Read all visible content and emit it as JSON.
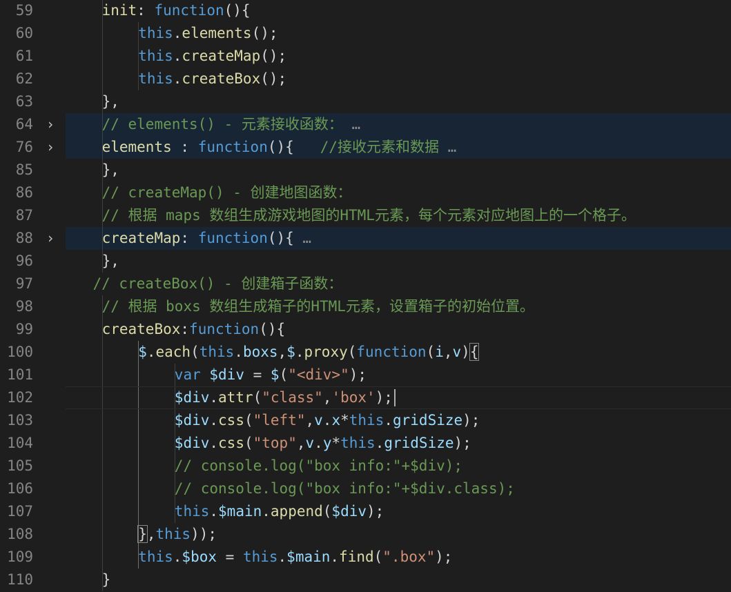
{
  "editor": {
    "theme": {
      "background": "#1e1e1e",
      "highlight": "#172534",
      "line_number": "#858585"
    },
    "lines": [
      {
        "n": "59",
        "fold": false,
        "hl": false,
        "indent": 2,
        "tokens": [
          {
            "t": "init",
            "c": "fn"
          },
          {
            "t": ": ",
            "c": "pn"
          },
          {
            "t": "function",
            "c": "kw"
          },
          {
            "t": "(){",
            "c": "pn"
          }
        ]
      },
      {
        "n": "60",
        "fold": false,
        "hl": false,
        "indent": 3,
        "tokens": [
          {
            "t": "this",
            "c": "kw"
          },
          {
            "t": ".",
            "c": "pn"
          },
          {
            "t": "elements",
            "c": "fn"
          },
          {
            "t": "();",
            "c": "pn"
          }
        ]
      },
      {
        "n": "61",
        "fold": false,
        "hl": false,
        "indent": 3,
        "tokens": [
          {
            "t": "this",
            "c": "kw"
          },
          {
            "t": ".",
            "c": "pn"
          },
          {
            "t": "createMap",
            "c": "fn"
          },
          {
            "t": "();",
            "c": "pn"
          }
        ]
      },
      {
        "n": "62",
        "fold": false,
        "hl": false,
        "indent": 3,
        "tokens": [
          {
            "t": "this",
            "c": "kw"
          },
          {
            "t": ".",
            "c": "pn"
          },
          {
            "t": "createBox",
            "c": "fn"
          },
          {
            "t": "();",
            "c": "pn"
          }
        ]
      },
      {
        "n": "63",
        "fold": false,
        "hl": false,
        "indent": 2,
        "tokens": [
          {
            "t": "},",
            "c": "pn"
          }
        ]
      },
      {
        "n": "64",
        "fold": true,
        "hl": true,
        "indent": 2,
        "tokens": [
          {
            "t": "// elements() - 元素接收函数：",
            "c": "cm"
          },
          {
            "t": " …",
            "c": "ell"
          }
        ]
      },
      {
        "n": "76",
        "fold": true,
        "hl": true,
        "indent": 2,
        "tokens": [
          {
            "t": "elements",
            "c": "fn"
          },
          {
            "t": " : ",
            "c": "pn"
          },
          {
            "t": "function",
            "c": "kw"
          },
          {
            "t": "(){   ",
            "c": "pn"
          },
          {
            "t": "//接收元素和数据",
            "c": "cm"
          },
          {
            "t": " …",
            "c": "ell"
          }
        ]
      },
      {
        "n": "85",
        "fold": false,
        "hl": false,
        "indent": 2,
        "tokens": [
          {
            "t": "},",
            "c": "pn"
          }
        ]
      },
      {
        "n": "86",
        "fold": false,
        "hl": false,
        "indent": 2,
        "tokens": [
          {
            "t": "// createMap() - 创建地图函数：",
            "c": "cm"
          }
        ]
      },
      {
        "n": "87",
        "fold": false,
        "hl": false,
        "indent": 2,
        "tokens": [
          {
            "t": "// 根据 maps 数组生成游戏地图的HTML元素，每个元素对应地图上的一个格子。",
            "c": "cm"
          }
        ]
      },
      {
        "n": "88",
        "fold": true,
        "hl": true,
        "indent": 2,
        "tokens": [
          {
            "t": "createMap",
            "c": "fn"
          },
          {
            "t": ": ",
            "c": "pn"
          },
          {
            "t": "function",
            "c": "kw"
          },
          {
            "t": "(){",
            "c": "pn"
          },
          {
            "t": " …",
            "c": "ell"
          }
        ]
      },
      {
        "n": "96",
        "fold": false,
        "hl": false,
        "indent": 2,
        "tokens": [
          {
            "t": "},",
            "c": "pn"
          }
        ]
      },
      {
        "n": "97",
        "fold": false,
        "hl": false,
        "indent": 1.75,
        "tokens": [
          {
            "t": "// createBox() - 创建箱子函数：",
            "c": "cm"
          }
        ]
      },
      {
        "n": "98",
        "fold": false,
        "hl": false,
        "indent": 2,
        "tokens": [
          {
            "t": "// 根据 boxs 数组生成箱子的HTML元素，设置箱子的初始位置。",
            "c": "cm"
          }
        ]
      },
      {
        "n": "99",
        "fold": false,
        "hl": false,
        "indent": 2,
        "tokens": [
          {
            "t": "createBox",
            "c": "fn"
          },
          {
            "t": ":",
            "c": "pn"
          },
          {
            "t": "function",
            "c": "kw"
          },
          {
            "t": "(){",
            "c": "pn"
          }
        ]
      },
      {
        "n": "100",
        "fold": false,
        "hl": false,
        "indent": 3,
        "tokens": [
          {
            "t": "$",
            "c": "vr"
          },
          {
            "t": ".",
            "c": "pn"
          },
          {
            "t": "each",
            "c": "fn"
          },
          {
            "t": "(",
            "c": "pn"
          },
          {
            "t": "this",
            "c": "kw"
          },
          {
            "t": ".",
            "c": "pn"
          },
          {
            "t": "boxs",
            "c": "pr"
          },
          {
            "t": ",",
            "c": "pn"
          },
          {
            "t": "$",
            "c": "vr"
          },
          {
            "t": ".",
            "c": "pn"
          },
          {
            "t": "proxy",
            "c": "fn"
          },
          {
            "t": "(",
            "c": "pn"
          },
          {
            "t": "function",
            "c": "kw"
          },
          {
            "t": "(",
            "c": "pn"
          },
          {
            "t": "i",
            "c": "pr"
          },
          {
            "t": ",",
            "c": "pn"
          },
          {
            "t": "v",
            "c": "pr"
          },
          {
            "t": ")",
            "c": "pn"
          },
          {
            "t": "{",
            "c": "pn",
            "box": true
          }
        ]
      },
      {
        "n": "101",
        "fold": false,
        "hl": false,
        "indent": 4,
        "tokens": [
          {
            "t": "var",
            "c": "kw"
          },
          {
            "t": " ",
            "c": "pn"
          },
          {
            "t": "$div",
            "c": "vr"
          },
          {
            "t": " = ",
            "c": "pn"
          },
          {
            "t": "$",
            "c": "vr"
          },
          {
            "t": "(",
            "c": "pn"
          },
          {
            "t": "\"<div>\"",
            "c": "str"
          },
          {
            "t": ");",
            "c": "pn"
          }
        ]
      },
      {
        "n": "102",
        "fold": false,
        "hl": false,
        "cur": true,
        "indent": 4,
        "tokens": [
          {
            "t": "$div",
            "c": "vr"
          },
          {
            "t": ".",
            "c": "pn"
          },
          {
            "t": "attr",
            "c": "fn"
          },
          {
            "t": "(",
            "c": "pn"
          },
          {
            "t": "\"class\"",
            "c": "str"
          },
          {
            "t": ",",
            "c": "pn"
          },
          {
            "t": "'box'",
            "c": "str"
          },
          {
            "t": ");",
            "c": "pn"
          }
        ]
      },
      {
        "n": "103",
        "fold": false,
        "hl": false,
        "indent": 4,
        "tokens": [
          {
            "t": "$div",
            "c": "vr"
          },
          {
            "t": ".",
            "c": "pn"
          },
          {
            "t": "css",
            "c": "fn"
          },
          {
            "t": "(",
            "c": "pn"
          },
          {
            "t": "\"left\"",
            "c": "str"
          },
          {
            "t": ",",
            "c": "pn"
          },
          {
            "t": "v",
            "c": "pr"
          },
          {
            "t": ".",
            "c": "pn"
          },
          {
            "t": "x",
            "c": "pr"
          },
          {
            "t": "*",
            "c": "pn"
          },
          {
            "t": "this",
            "c": "kw"
          },
          {
            "t": ".",
            "c": "pn"
          },
          {
            "t": "gridSize",
            "c": "pr"
          },
          {
            "t": ");",
            "c": "pn"
          }
        ]
      },
      {
        "n": "104",
        "fold": false,
        "hl": false,
        "indent": 4,
        "tokens": [
          {
            "t": "$div",
            "c": "vr"
          },
          {
            "t": ".",
            "c": "pn"
          },
          {
            "t": "css",
            "c": "fn"
          },
          {
            "t": "(",
            "c": "pn"
          },
          {
            "t": "\"top\"",
            "c": "str"
          },
          {
            "t": ",",
            "c": "pn"
          },
          {
            "t": "v",
            "c": "pr"
          },
          {
            "t": ".",
            "c": "pn"
          },
          {
            "t": "y",
            "c": "pr"
          },
          {
            "t": "*",
            "c": "pn"
          },
          {
            "t": "this",
            "c": "kw"
          },
          {
            "t": ".",
            "c": "pn"
          },
          {
            "t": "gridSize",
            "c": "pr"
          },
          {
            "t": ");",
            "c": "pn"
          }
        ]
      },
      {
        "n": "105",
        "fold": false,
        "hl": false,
        "indent": 4,
        "tokens": [
          {
            "t": "// console.log(\"box info:\"+$div);",
            "c": "cm"
          }
        ]
      },
      {
        "n": "106",
        "fold": false,
        "hl": false,
        "indent": 4,
        "tokens": [
          {
            "t": "// console.log(\"box info:\"+$div.class);",
            "c": "cm"
          }
        ]
      },
      {
        "n": "107",
        "fold": false,
        "hl": false,
        "indent": 4,
        "tokens": [
          {
            "t": "this",
            "c": "kw"
          },
          {
            "t": ".",
            "c": "pn"
          },
          {
            "t": "$main",
            "c": "vr"
          },
          {
            "t": ".",
            "c": "pn"
          },
          {
            "t": "append",
            "c": "fn"
          },
          {
            "t": "(",
            "c": "pn"
          },
          {
            "t": "$div",
            "c": "vr"
          },
          {
            "t": ");",
            "c": "pn"
          }
        ]
      },
      {
        "n": "108",
        "fold": false,
        "hl": false,
        "indent": 3,
        "tokens": [
          {
            "t": "}",
            "c": "pn",
            "box": true
          },
          {
            "t": ",",
            "c": "pn"
          },
          {
            "t": "this",
            "c": "kw"
          },
          {
            "t": "));",
            "c": "pn"
          }
        ]
      },
      {
        "n": "109",
        "fold": false,
        "hl": false,
        "indent": 3,
        "tokens": [
          {
            "t": "this",
            "c": "kw"
          },
          {
            "t": ".",
            "c": "pn"
          },
          {
            "t": "$box",
            "c": "vr"
          },
          {
            "t": " = ",
            "c": "pn"
          },
          {
            "t": "this",
            "c": "kw"
          },
          {
            "t": ".",
            "c": "pn"
          },
          {
            "t": "$main",
            "c": "vr"
          },
          {
            "t": ".",
            "c": "pn"
          },
          {
            "t": "find",
            "c": "fn"
          },
          {
            "t": "(",
            "c": "pn"
          },
          {
            "t": "\".box\"",
            "c": "str"
          },
          {
            "t": ");",
            "c": "pn"
          }
        ]
      },
      {
        "n": "110",
        "fold": false,
        "hl": false,
        "indent": 2,
        "tokens": [
          {
            "t": "}",
            "c": "pn"
          }
        ]
      }
    ]
  }
}
